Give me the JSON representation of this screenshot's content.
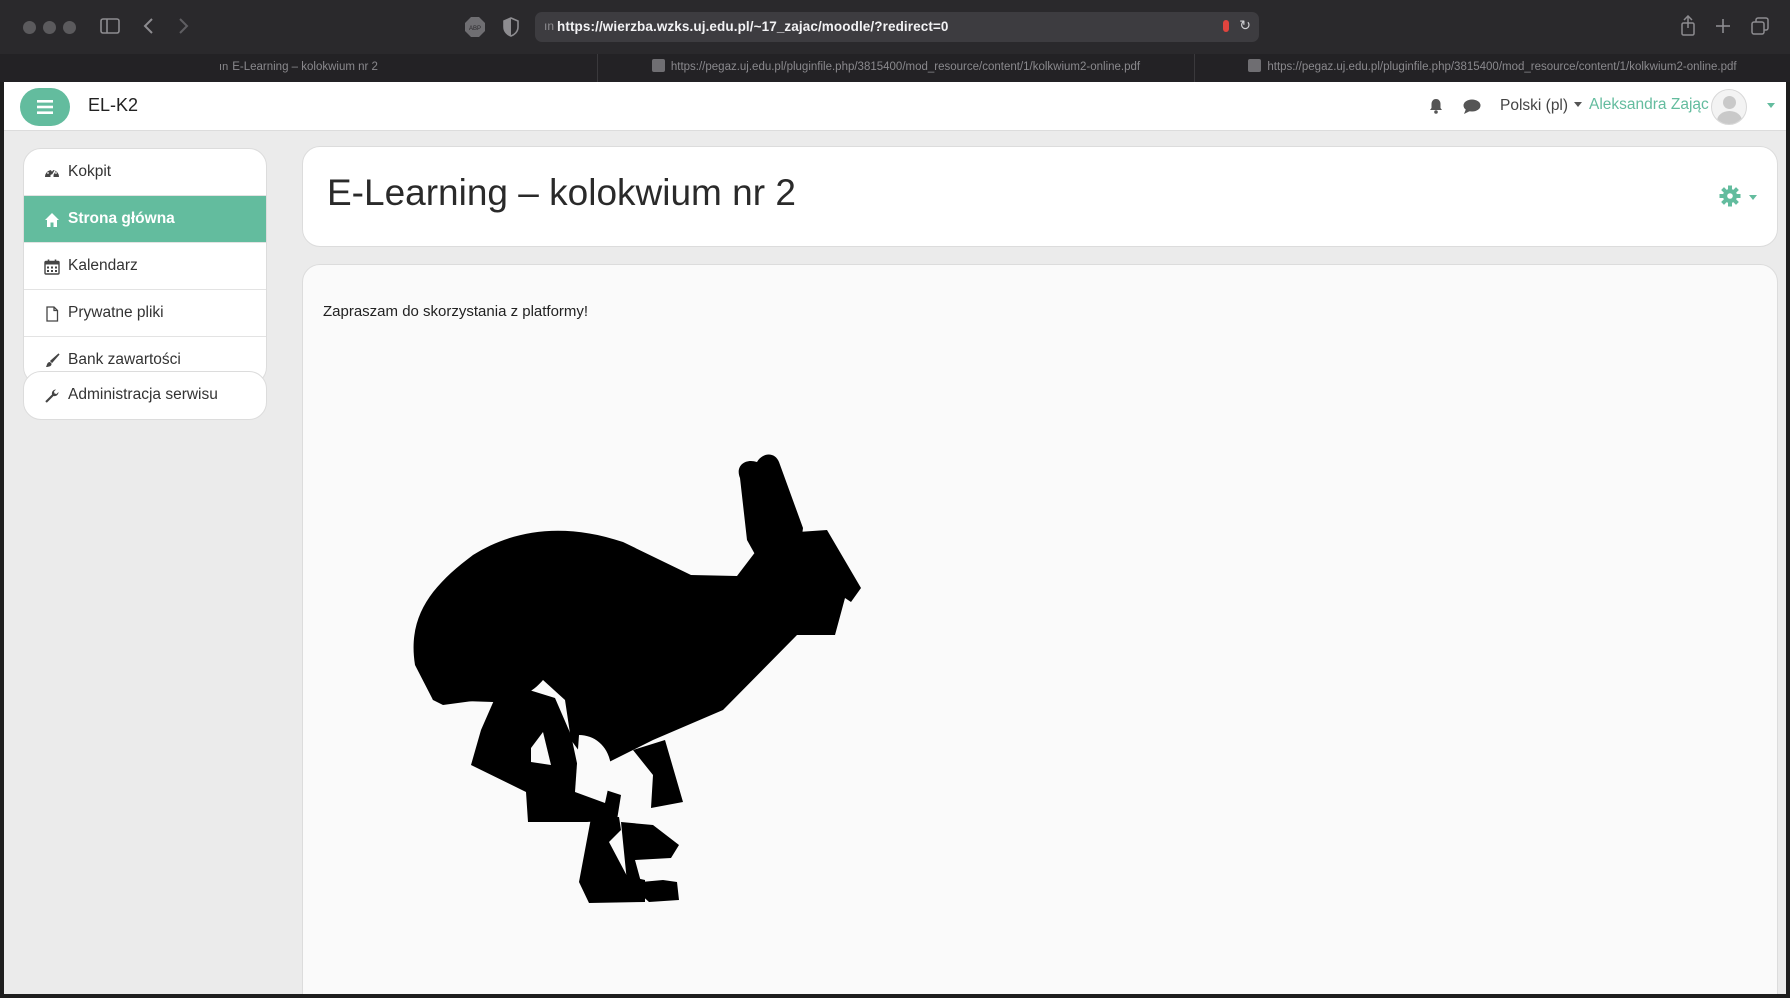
{
  "browser": {
    "url": "https://wierzba.wzks.uj.edu.pl/~17_zajac/moodle/?redirect=0",
    "tabs": [
      {
        "title": "E-Learning – kolokwium nr 2"
      },
      {
        "title": "https://pegaz.uj.edu.pl/pluginfile.php/3815400/mod_resource/content/1/kolkwium2-online.pdf"
      },
      {
        "title": "https://pegaz.uj.edu.pl/pluginfile.php/3815400/mod_resource/content/1/kolkwium2-online.pdf"
      }
    ]
  },
  "navbar": {
    "site_name": "EL-K2",
    "language": "Polski (pl)",
    "user_name": "Aleksandra Zając",
    "accent_color": "#63bc9e"
  },
  "sidebar": {
    "items": [
      {
        "label": "Kokpit",
        "icon": "dashboard-icon",
        "active": false
      },
      {
        "label": "Strona główna",
        "icon": "home-icon",
        "active": true
      },
      {
        "label": "Kalendarz",
        "icon": "calendar-icon",
        "active": false
      },
      {
        "label": "Prywatne pliki",
        "icon": "file-icon",
        "active": false
      },
      {
        "label": "Bank zawartości",
        "icon": "brush-icon",
        "active": false
      }
    ],
    "admin": {
      "label": "Administracja serwisu",
      "icon": "wrench-icon"
    }
  },
  "main": {
    "title": "E-Learning – kolokwium nr 2",
    "intro_text": "Zapraszam do skorzystania z platformy!"
  }
}
